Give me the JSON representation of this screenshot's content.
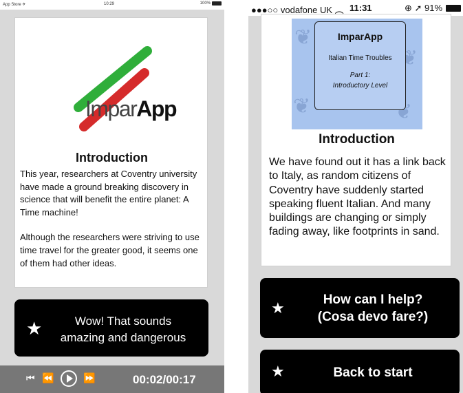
{
  "left_screen": {
    "status_bar": {
      "carrier": "App Store ✈",
      "time": "10:29",
      "battery": "100%"
    },
    "logo": {
      "text_light": "Impar",
      "text_bold": "App",
      "colors": {
        "green": "#2fae3a",
        "red": "#d52b2b"
      }
    },
    "title": "Introduction",
    "paragraphs": [
      "This year, researchers at Coventry university have made a ground breaking discovery in science that will benefit the entire planet: A Time machine!",
      "Although the researchers were striving to use time travel for the greater good, it seems one of them had other ideas."
    ],
    "choice_button": {
      "icon": "star-icon",
      "label_line1": "Wow! That sounds",
      "label_line2": "amazing and dangerous"
    },
    "player": {
      "controls": {
        "skip_back": "⏮",
        "rewind": "⏪",
        "fast_forward": "⏩"
      },
      "time": "00:02/00:17"
    }
  },
  "right_screen": {
    "status_bar": {
      "carrier": "●●●○○ vodafone UK",
      "wifi": "wifi",
      "time": "11:31",
      "icons": "⊕ ➚ 91%"
    },
    "cover": {
      "title": "ImparApp",
      "subtitle": "Italian Time Troubles",
      "part_line1": "Part 1:",
      "part_line2": "Introductory Level",
      "color": "#a8c4ee"
    },
    "title": "Introduction",
    "body": "We have found out it has a link back to Italy, as random citizens of Coventry have suddenly started speaking fluent Italian. And many buildings are changing or simply fading away, like footprints in sand.",
    "help_button": {
      "icon": "star-icon",
      "label_line1": "How can I help?",
      "label_line2": "(Cosa devo fare?)"
    },
    "back_button": {
      "icon": "star-icon",
      "label": "Back to start"
    }
  }
}
